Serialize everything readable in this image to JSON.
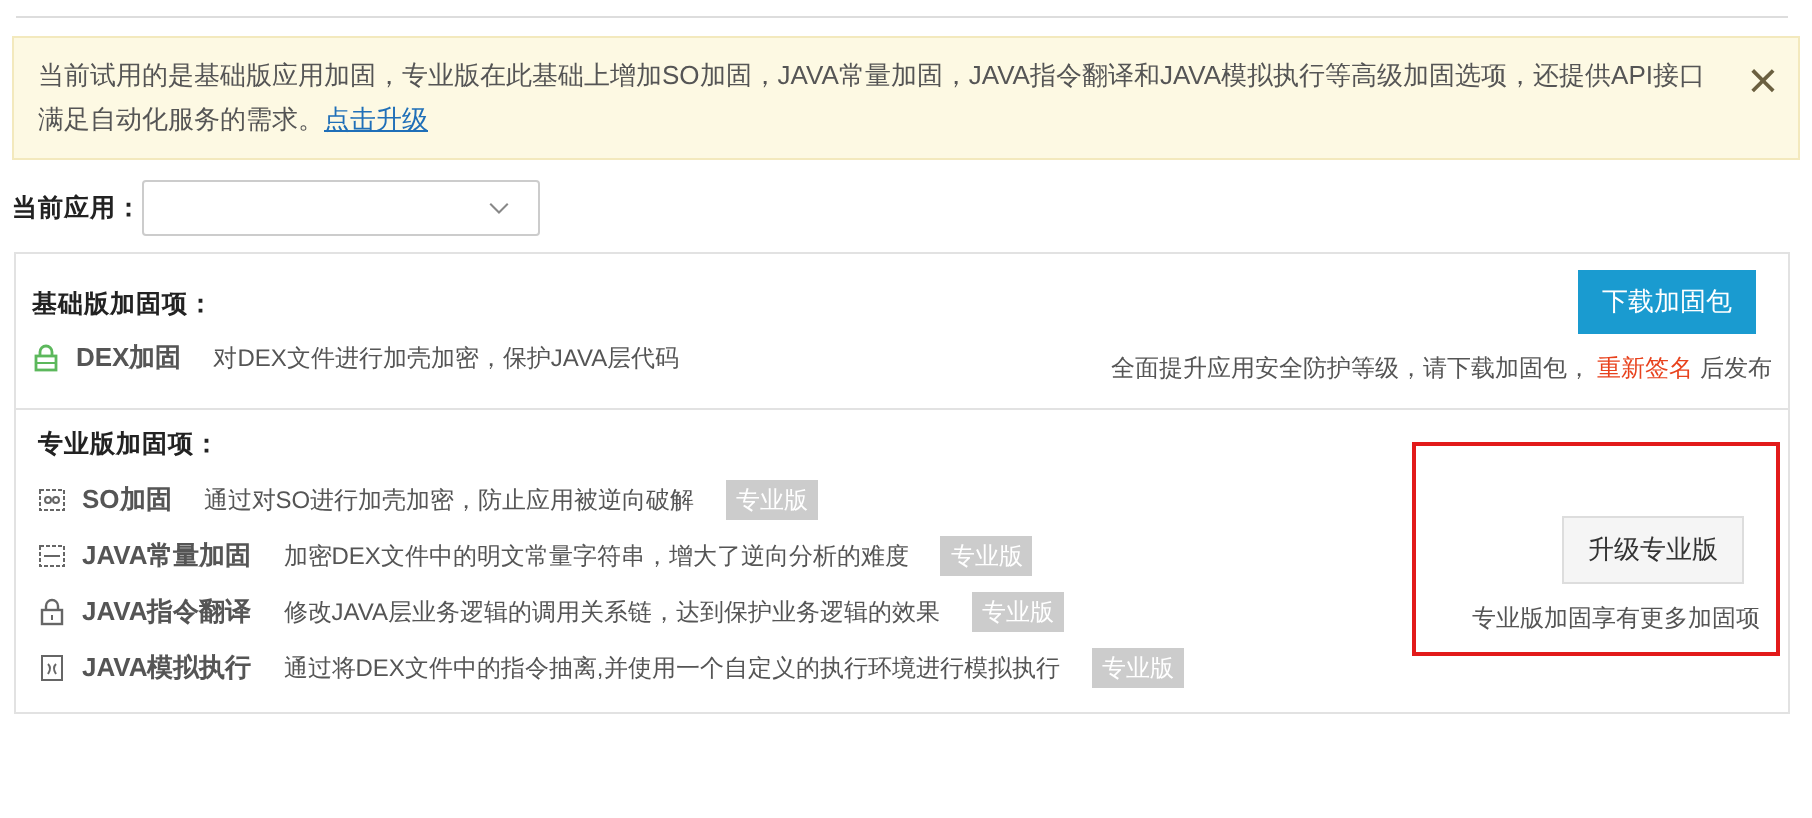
{
  "notice": {
    "text": "当前试用的是基础版应用加固，专业版在此基础上增加SO加固，JAVA常量加固，JAVA指令翻译和JAVA模拟执行等高级加固选项，还提供API接口满足自动化服务的需求。",
    "link": "点击升级",
    "close": "×"
  },
  "app_select": {
    "label": "当前应用："
  },
  "basic": {
    "title": "基础版加固项：",
    "items": [
      {
        "kind": "lock-green",
        "name": "DEX加固",
        "desc": "对DEX文件进行加壳加密，保护JAVA层代码"
      }
    ],
    "button": "下载加固包",
    "note_before": "全面提升应用安全防护等级，请下载加固包，",
    "note_link": "重新签名",
    "note_after": "后发布"
  },
  "pro": {
    "title": "专业版加固项：",
    "items": [
      {
        "kind": "so",
        "name": "SO加固",
        "desc": "通过对SO进行加壳加密，防止应用被逆向破解",
        "tag": "专业版"
      },
      {
        "kind": "dex",
        "name": "JAVA常量加固",
        "desc": "加密DEX文件中的明文常量字符串，增大了逆向分析的难度",
        "tag": "专业版"
      },
      {
        "kind": "lock",
        "name": "JAVA指令翻译",
        "desc": "修改JAVA层业务逻辑的调用关系链，达到保护业务逻辑的效果",
        "tag": "专业版"
      },
      {
        "kind": "fx",
        "name": "JAVA模拟执行",
        "desc": "通过将DEX文件中的指令抽离,并使用一个自定义的执行环境进行模拟执行",
        "tag": "专业版"
      }
    ],
    "button": "升级专业版",
    "note": "专业版加固享有更多加固项",
    "highlighted": true
  }
}
